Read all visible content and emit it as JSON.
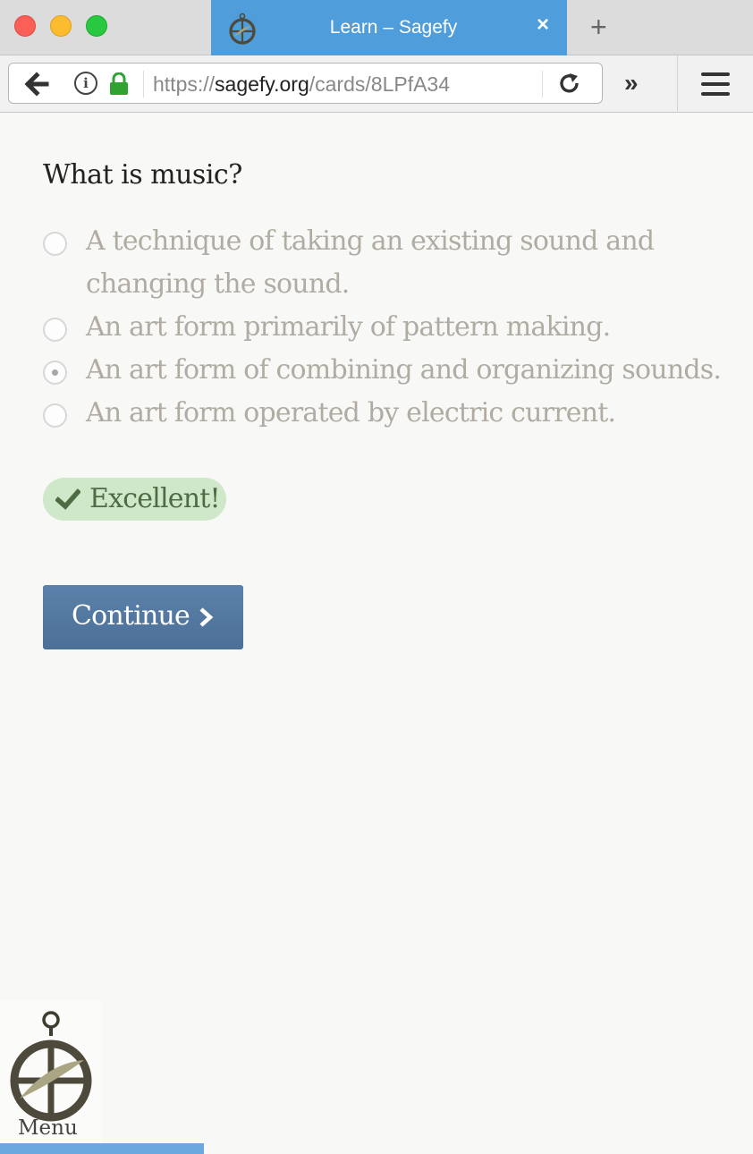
{
  "browser": {
    "tab_title": "Learn – Sagefy",
    "tab_close": "×",
    "new_tab": "+",
    "url_prefix": "https://",
    "url_host": "sagefy.org",
    "url_path": "/cards/8LPfA34",
    "overflow": "»",
    "info_glyph": "i"
  },
  "card": {
    "question": "What is music?",
    "options": [
      {
        "label": "A technique of taking an existing sound and changing the sound.",
        "selected": false
      },
      {
        "label": "An art form primarily of pattern making.",
        "selected": false
      },
      {
        "label": "An art form of combining and organizing sounds.",
        "selected": true
      },
      {
        "label": "An art form operated by electric current.",
        "selected": false
      }
    ],
    "feedback": "Excellent!",
    "continue_label": "Continue"
  },
  "menu": {
    "label": "Menu"
  },
  "colors": {
    "tab_active": "#4f9ddb",
    "feedback_bg": "#cfe8ca",
    "feedback_text": "#4e6c44",
    "button": "#4f759c",
    "progress": "#6aa8de"
  },
  "icons": [
    "back-arrow-icon",
    "info-icon",
    "lock-icon",
    "reload-icon",
    "overflow-icon",
    "hamburger-icon",
    "checkmark-icon",
    "chevron-right-icon",
    "sagefy-logo-icon"
  ]
}
